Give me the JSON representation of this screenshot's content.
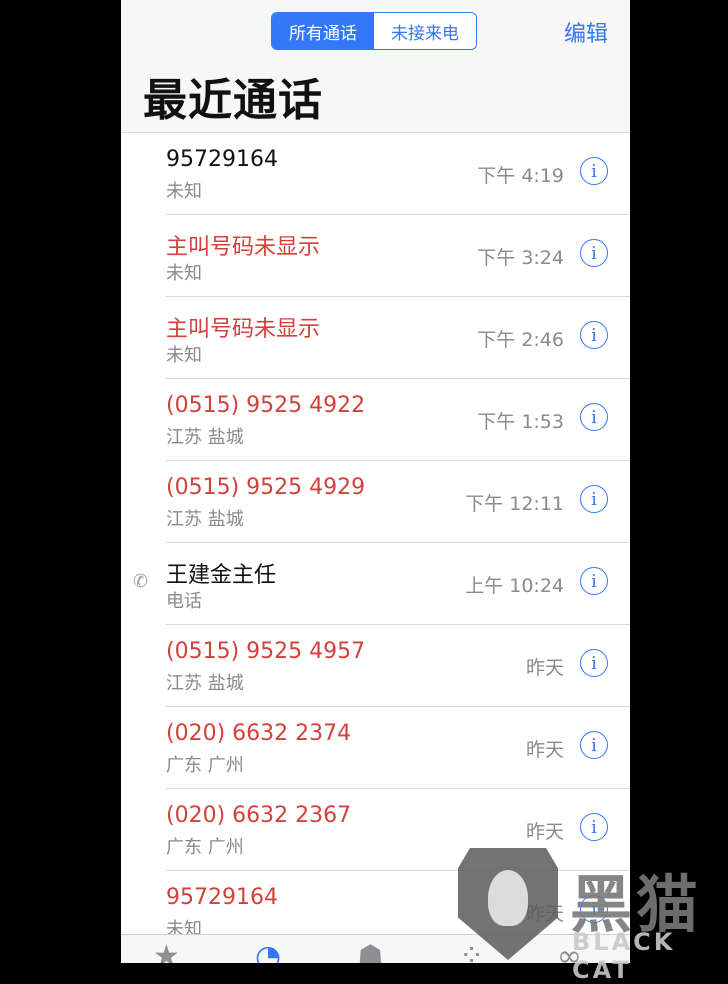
{
  "header": {
    "segments": [
      {
        "label": "所有通话",
        "active": true
      },
      {
        "label": "未接来电",
        "active": false
      }
    ],
    "edit_label": "编辑",
    "title": "最近通话"
  },
  "calls": [
    {
      "name": "95729164",
      "sub": "未知",
      "time": "下午 4:19",
      "missed": false,
      "outgoing": false
    },
    {
      "name": "主叫号码未显示",
      "sub": "未知",
      "time": "下午 3:24",
      "missed": true,
      "outgoing": false
    },
    {
      "name": "主叫号码未显示",
      "sub": "未知",
      "time": "下午 2:46",
      "missed": true,
      "outgoing": false
    },
    {
      "name": "(0515) 9525 4922",
      "sub": "江苏 盐城",
      "time": "下午 1:53",
      "missed": true,
      "outgoing": false
    },
    {
      "name": "(0515) 9525 4929",
      "sub": "江苏 盐城",
      "time": "下午 12:11",
      "missed": true,
      "outgoing": false
    },
    {
      "name": "王建金主任",
      "sub": "电话",
      "time": "上午 10:24",
      "missed": false,
      "outgoing": true
    },
    {
      "name": "(0515) 9525 4957",
      "sub": "江苏 盐城",
      "time": "昨天",
      "missed": true,
      "outgoing": false
    },
    {
      "name": "(020) 6632 2374",
      "sub": "广东 广州",
      "time": "昨天",
      "missed": true,
      "outgoing": false
    },
    {
      "name": "(020) 6632 2367",
      "sub": "广东 广州",
      "time": "昨天",
      "missed": true,
      "outgoing": false
    },
    {
      "name": "95729164",
      "sub": "未知",
      "time": "昨天",
      "missed": true,
      "outgoing": false
    }
  ],
  "tabbar": {
    "icons": [
      "star-icon",
      "clock-icon",
      "contacts-icon",
      "keypad-icon",
      "voicemail-icon"
    ],
    "active": "clock-icon"
  },
  "watermark": {
    "text": "黑猫",
    "sub": "BLACK CAT"
  },
  "colors": {
    "accent": "#3478f6",
    "missed": "#d2423b"
  }
}
